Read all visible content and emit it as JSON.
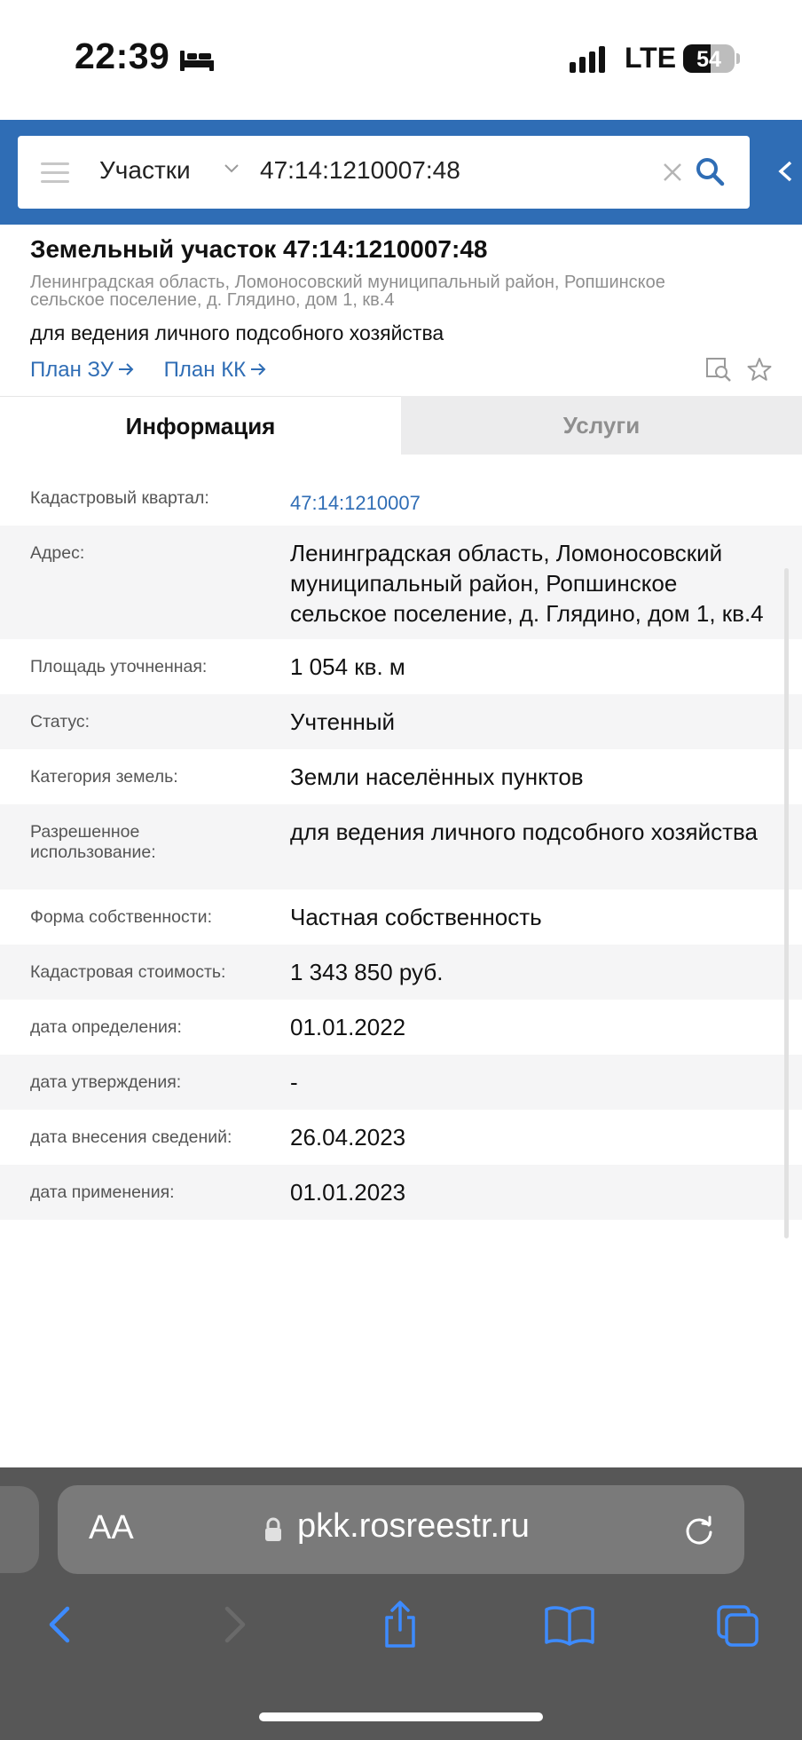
{
  "status": {
    "time": "22:39",
    "network": "LTE",
    "battery": "54",
    "battery_fraction": 0.54
  },
  "search": {
    "category": "Участки",
    "query": "47:14:1210007:48"
  },
  "parcel": {
    "title": "Земельный участок 47:14:1210007:48",
    "address": "Ленинградская область, Ломоносовский муниципальный район, Ропшинское сельское поселение, д. Глядино, дом 1, кв.4",
    "purpose": "для ведения личного подсобного хозяйства",
    "links": [
      "План ЗУ",
      "План КК"
    ]
  },
  "tabs": [
    "Информация",
    "Услуги"
  ],
  "rows": [
    {
      "label": "Кадастровый квартал:",
      "value": "47:14:1210007",
      "is_link": true
    },
    {
      "label": "Адрес:",
      "value": "Ленинградская область, Ломоносовский муниципальный район, Ропшинское сельское поселение, д. Глядино, дом 1, кв.4"
    },
    {
      "label": "Площадь уточненная:",
      "value": "1 054 кв. м"
    },
    {
      "label": "Статус:",
      "value": "Учтенный"
    },
    {
      "label": "Категория земель:",
      "value": "Земли населённых пунктов"
    },
    {
      "label": "Разрешенное использование:",
      "value": "для ведения личного подсобного хозяйства"
    },
    {
      "label": "Форма собственности:",
      "value": "Частная собственность"
    },
    {
      "label": "Кадастровая стоимость:",
      "value": "1 343 850 руб."
    },
    {
      "label": "дата определения:",
      "value": "01.01.2022"
    },
    {
      "label": "дата утверждения:",
      "value": "-"
    },
    {
      "label": "дата внесения сведений:",
      "value": "26.04.2023"
    },
    {
      "label": "дата применения:",
      "value": "01.01.2023"
    }
  ],
  "browser": {
    "text_size_label": "AA",
    "url": "pkk.rosreestr.ru"
  },
  "icons": [
    "bed-icon",
    "menu-icon",
    "chevron-down-icon",
    "clear-icon",
    "search-icon",
    "chevron-left-icon",
    "arrow-right-icon",
    "map-search-icon",
    "star-icon",
    "lock-icon",
    "reload-icon",
    "back-icon",
    "forward-icon",
    "share-icon",
    "bookmarks-icon",
    "tabs-icon"
  ],
  "colors": {
    "header_blue": "#2f6db5",
    "link": "#2f6db5",
    "safari_bar": "#575757",
    "ios_blue": "#3d8bff"
  }
}
